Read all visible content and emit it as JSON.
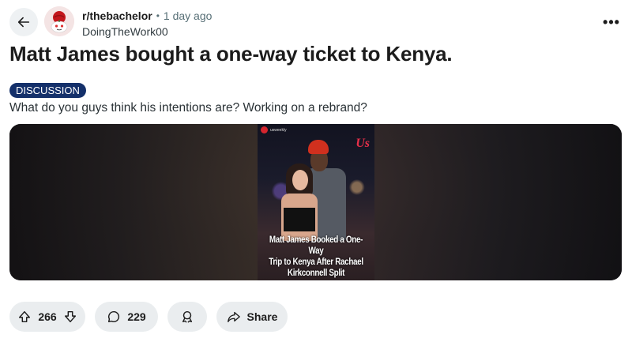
{
  "header": {
    "subreddit": "r/thebachelor",
    "separator": "•",
    "time_ago": "1 day ago",
    "author": "DoingTheWork00",
    "more_label": "•••"
  },
  "post": {
    "title": "Matt James bought a one-way ticket to Kenya.",
    "flair": "DISCUSSION",
    "body": "What do you guys think his intentions are? Working on a rebrand?"
  },
  "media": {
    "source_handle": "usweekly",
    "brand_logo": "Us",
    "caption_lines": [
      "Matt James Booked a One-Way",
      "Trip to Kenya After Rachael",
      "Kirkconnell Split"
    ]
  },
  "actions": {
    "vote_count": "266",
    "comment_count": "229",
    "share_label": "Share"
  },
  "icons": {
    "back": "back-arrow-icon",
    "upvote": "upvote-icon",
    "downvote": "downvote-icon",
    "comment": "comment-icon",
    "award": "award-icon",
    "share": "share-icon"
  },
  "colors": {
    "flair_bg": "#14306a",
    "pill_bg": "#eaedef",
    "page_bg": "#ffffff"
  }
}
